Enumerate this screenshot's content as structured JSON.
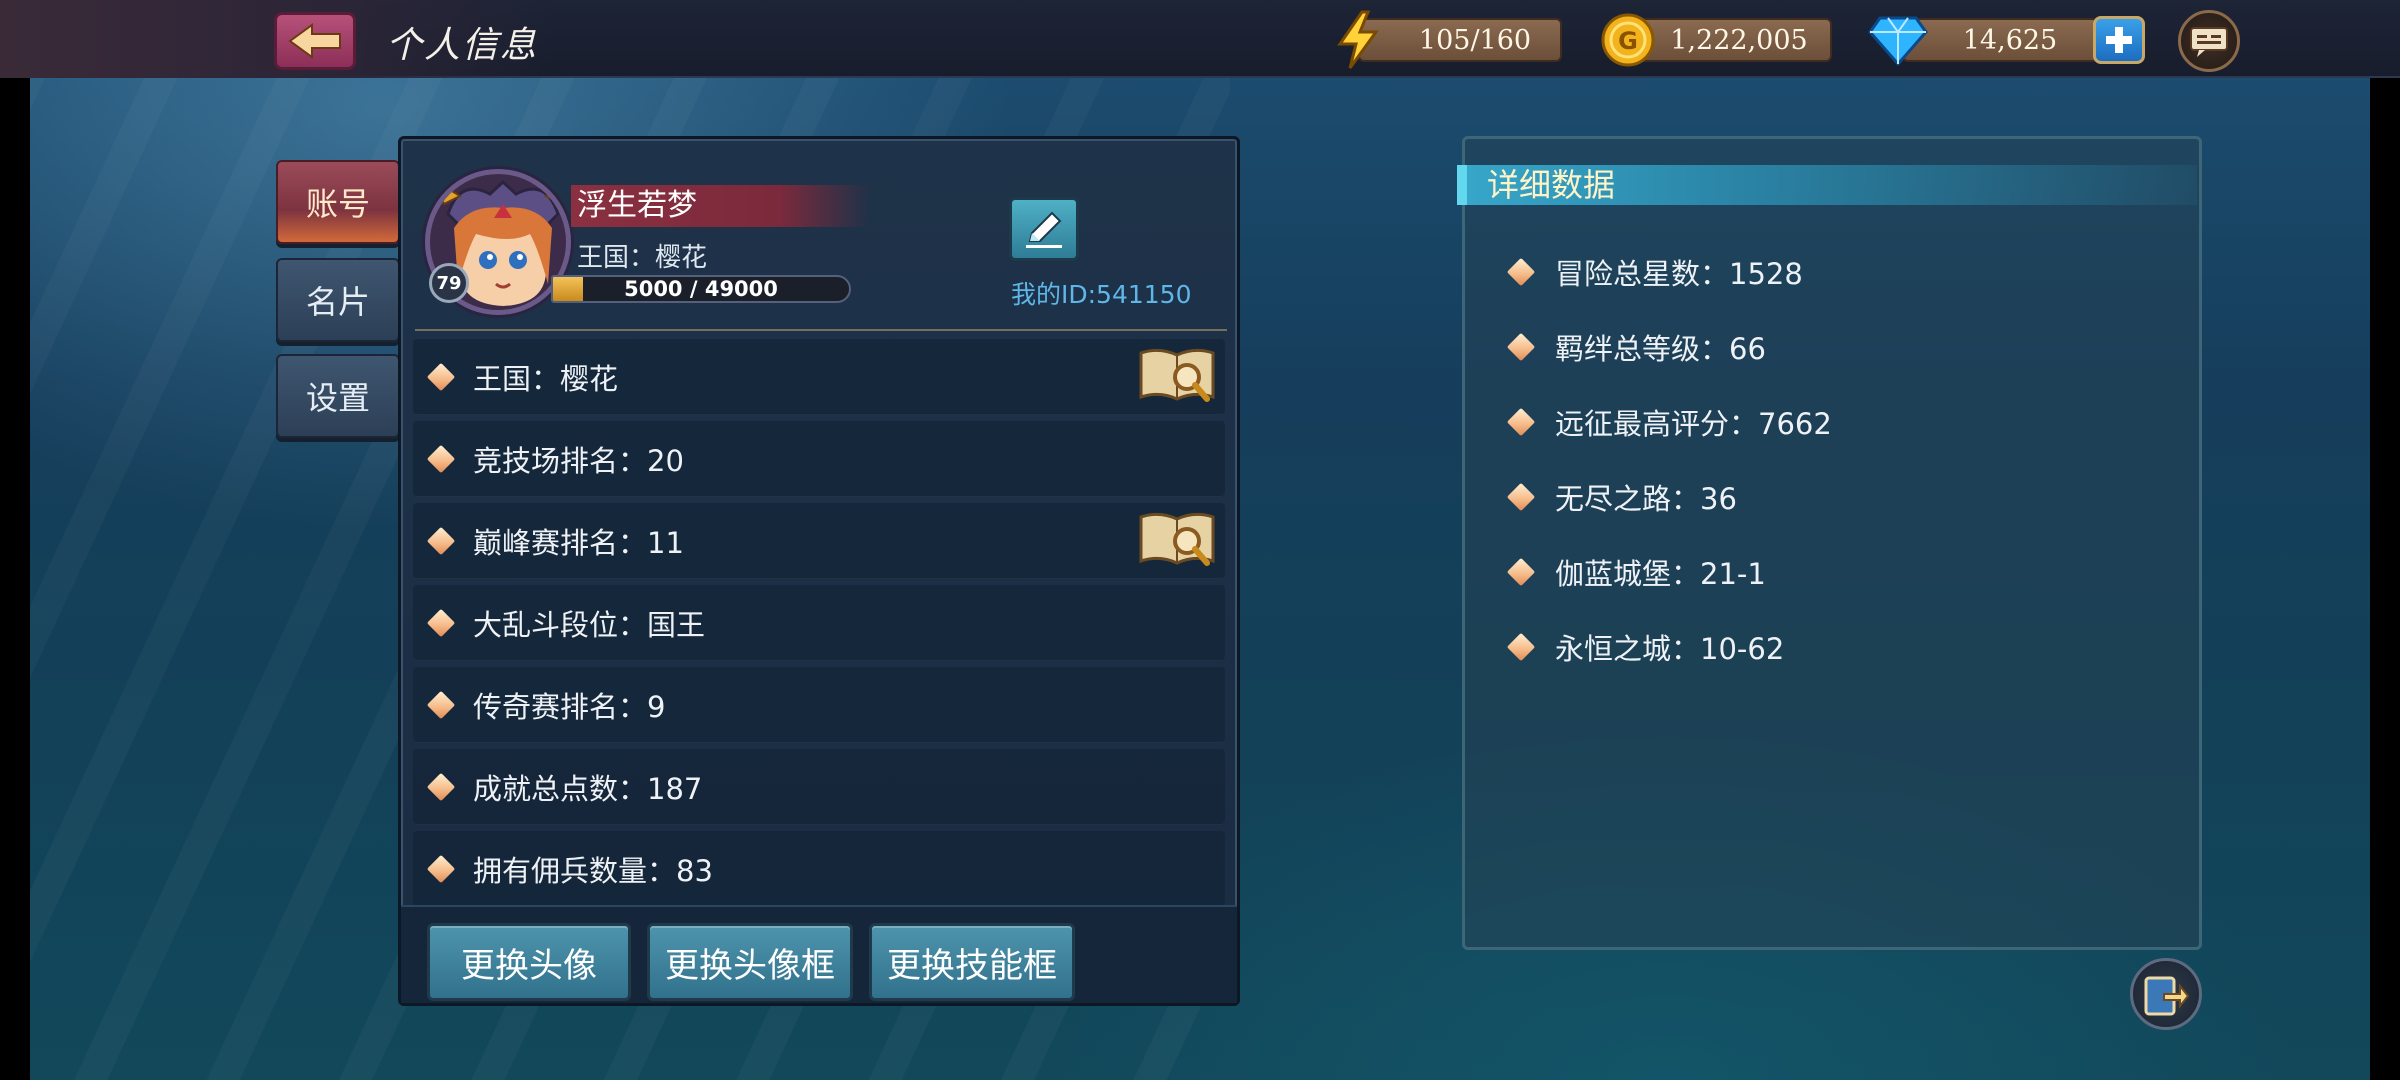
{
  "header": {
    "title": "个人信息",
    "energy": "105/160",
    "gold": "1,222,005",
    "gems": "14,625"
  },
  "tabs": [
    {
      "label": "账号",
      "active": true
    },
    {
      "label": "名片",
      "active": false
    },
    {
      "label": "设置",
      "active": false
    }
  ],
  "profile": {
    "name": "浮生若梦",
    "kingdom": "王国：樱花",
    "level": "79",
    "exp_text": "5000 / 49000",
    "exp_progress": 0.102,
    "my_id": "我的ID:541150"
  },
  "stats": [
    {
      "text": "王国：樱花",
      "has_lookup": true
    },
    {
      "text": "竞技场排名：20",
      "has_lookup": false
    },
    {
      "text": "巅峰赛排名：11",
      "has_lookup": true
    },
    {
      "text": "大乱斗段位：国王",
      "has_lookup": false
    },
    {
      "text": "传奇赛排名：9",
      "has_lookup": false
    },
    {
      "text": "成就总点数：187",
      "has_lookup": false
    },
    {
      "text": "拥有佣兵数量：83",
      "has_lookup": false
    }
  ],
  "actions": {
    "change_avatar": "更换头像",
    "change_frame": "更换头像框",
    "change_skill_frame": "更换技能框"
  },
  "details": {
    "title": "详细数据",
    "items": [
      "冒险总星数：1528",
      "羁绊总等级：66",
      "远征最高评分：7662",
      "无尽之路：36",
      "伽蓝城堡：21-1",
      "永恒之城：10-62"
    ]
  },
  "colors": {
    "accent_cyan": "#37a6c9",
    "active_tab": "#9b4b59",
    "button_teal": "#4e94ac"
  }
}
